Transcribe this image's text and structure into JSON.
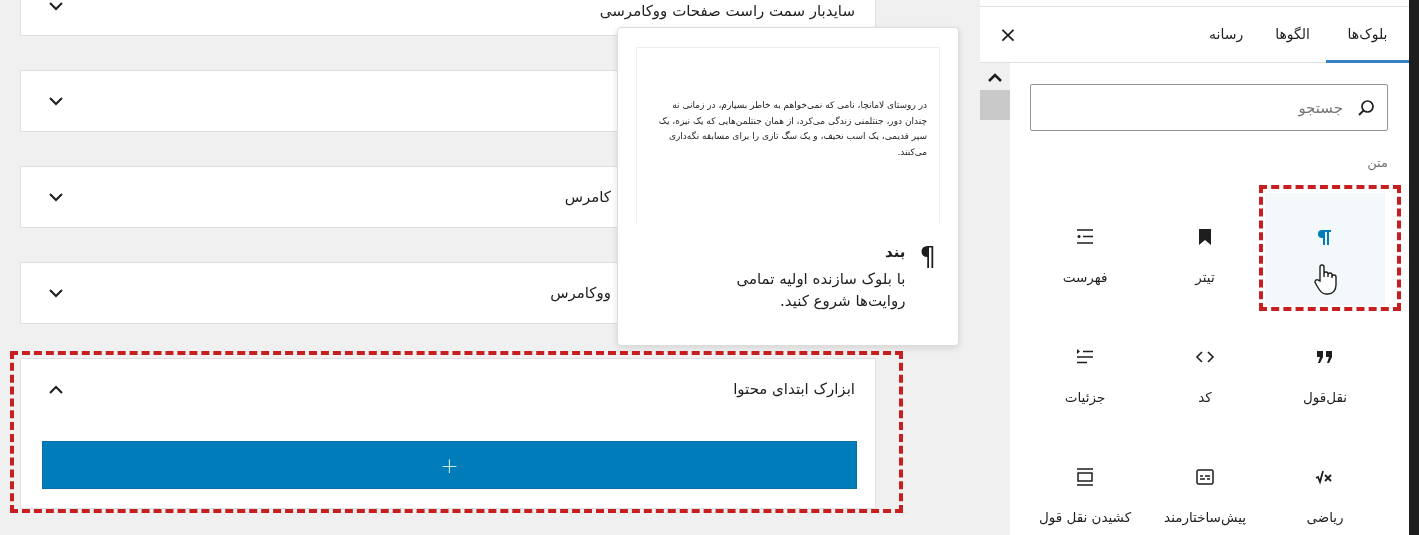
{
  "panels": [
    {
      "title": "سایدبار سمت راست صفحات ووکامرسی",
      "expanded": false
    },
    {
      "expanded": false
    },
    {
      "title": "کامرس",
      "expanded": false
    },
    {
      "title": "ووکامرس",
      "expanded": false
    },
    {
      "title": "ابزارک ابتدای محتوا",
      "expanded": true,
      "annotated": true,
      "add_button": "+"
    }
  ],
  "preview_popover": {
    "preview_text": "در روستای لامانچا، نامی که نمی‌خواهم به خاطر بسپارم، در زمانی نه چندان دور، جنتلمنی زندگی می‌کرد، از همان جنتلمن‌هایی که یک نیزه، یک سپر قدیمی، یک اسب نحیف، و یک سگ تازی را برای مسابقه نگه‌داری می‌کنند.",
    "icon": "¶",
    "title": "بند",
    "description": "با بلوک سازنده اولیه تمامی روایت‌ها شروع کنید."
  },
  "inserter": {
    "tabs": [
      {
        "label": "بلوک‌ها",
        "selected": true
      },
      {
        "label": "الگوها",
        "selected": false
      },
      {
        "label": "رسانه",
        "selected": false
      }
    ],
    "close": "×",
    "search": {
      "placeholder": "جستجو"
    },
    "category": "متن",
    "blocks": [
      {
        "kind": "paragraph",
        "hovered": true,
        "annotated": true
      },
      {
        "label": "تیتر",
        "kind": "heading",
        "hovered": false
      },
      {
        "label": "فهرست",
        "kind": "list",
        "hovered": false
      },
      {
        "label": "نقل‌قول",
        "kind": "quote",
        "hovered": false
      },
      {
        "label": "کد",
        "kind": "code",
        "hovered": false
      },
      {
        "label": "جزئیات",
        "kind": "details",
        "hovered": false
      },
      {
        "label": "ریاضی",
        "kind": "math",
        "hovered": false
      },
      {
        "label": "پیش‌ساختارمند",
        "kind": "preformatted",
        "hovered": false
      },
      {
        "label": "کشیدن نقل قول",
        "kind": "pullquote",
        "hovered": false
      }
    ]
  }
}
